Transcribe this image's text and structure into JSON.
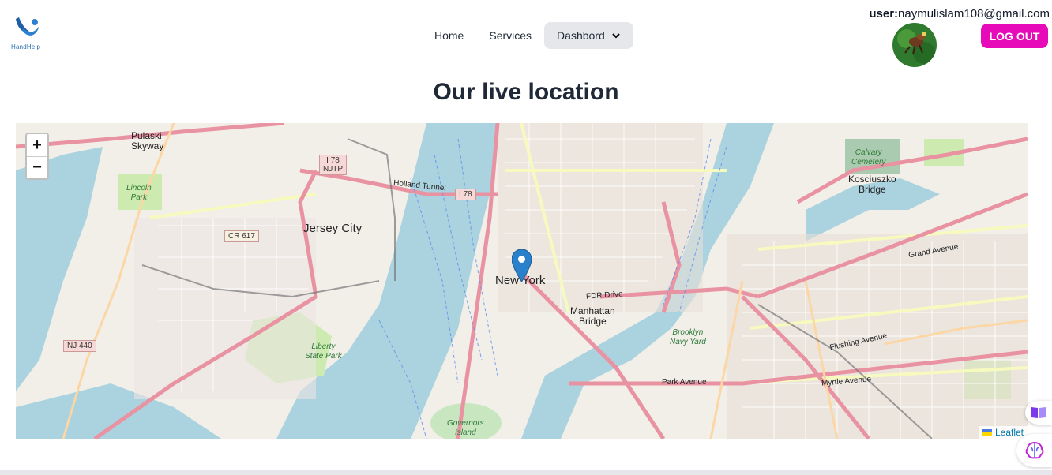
{
  "header": {
    "logo_text": "HandHelp",
    "nav": [
      {
        "label": "Home"
      },
      {
        "label": "Services"
      },
      {
        "label": "Dashbord"
      }
    ],
    "user_prefix": "user:",
    "user_email": "naymulislam108@gmail.com",
    "logout_label": "LOG OUT",
    "logout_color": "#e60ab9"
  },
  "page": {
    "title": "Our live location"
  },
  "map": {
    "zoom_in": "+",
    "zoom_out": "−",
    "attribution": "Leaflet",
    "marker_label": "New York",
    "labels": {
      "pulaski": "Pulaski\nSkyway",
      "jersey_city": "Jersey City",
      "new_york": "New York",
      "manhattan_bridge": "Manhattan\nBridge",
      "brooklyn_navy_yard": "Brooklyn\nNavy Yard",
      "liberty_park": "Liberty\nState Park",
      "lincoln_park": "Lincoln\nPark",
      "calvary": "Calvary\nCemetery",
      "kosciuszko": "Kosciuszko\nBridge",
      "governors": "Governors\nIsland",
      "holland": "Holland Tunnel",
      "fdr": "FDR Drive",
      "myrtle": "Myrtle Avenue",
      "grand": "Grand Avenue",
      "flushing": "Flushing Avenue",
      "park_ave": "Park Avenue"
    },
    "shields": {
      "i78_njtp": "I 78\nNJTP",
      "i78": "I 78",
      "cr617": "CR 617",
      "nj440": "NJ 440"
    }
  }
}
